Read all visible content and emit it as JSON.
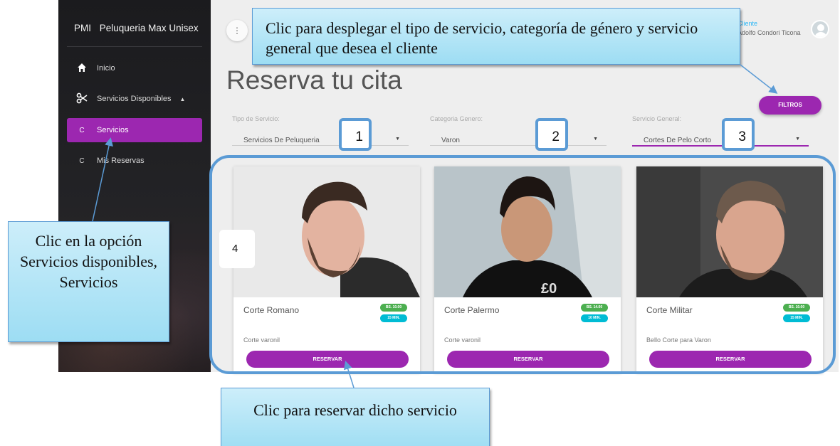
{
  "sidebar": {
    "brand_abbr": "PMI",
    "brand_name": "Peluqueria Max Unisex",
    "items": [
      {
        "icon": "home-icon",
        "label": "Inicio"
      },
      {
        "icon": "scissors-icon",
        "label": "Servicios Disponibles"
      },
      {
        "letter": "C",
        "label": "Servicios",
        "active": true
      },
      {
        "letter": "C",
        "label": "Mis Reservas"
      }
    ]
  },
  "header": {
    "user_role": "Cliente",
    "user_name": "Adolfo Condori Ticona"
  },
  "main": {
    "title": "Reserva tu cita",
    "filters_button": "FILTROS",
    "filters": [
      {
        "label": "Tipo de Servicio:",
        "value": "Servicios De Peluqueria"
      },
      {
        "label": "Categoria Genero:",
        "value": "Varon"
      },
      {
        "label": "Servicio General:",
        "value": "Cortes De Pelo Corto"
      }
    ],
    "cards": [
      {
        "name": "Corte Romano",
        "price": "BS. 10.00",
        "time": "15 MIN.",
        "description": "Corte varonil",
        "button": "RESERVAR"
      },
      {
        "name": "Corte Palermo",
        "price": "BS. 14.00",
        "time": "10 MIN.",
        "description": "Corte varonil",
        "button": "RESERVAR"
      },
      {
        "name": "Corte Militar",
        "price": "BS. 10.00",
        "time": "15 MIN.",
        "description": "Bello Corte para Varon",
        "button": "RESERVAR"
      }
    ]
  },
  "annotations": {
    "top_callout": "Clic para desplegar el tipo de servicio, categoría de género y servicio general que desea el cliente",
    "left_callout": "Clic en la opción Servicios disponibles, Servicios",
    "bottom_callout": "Clic para reservar dicho servicio",
    "markers": [
      "1",
      "2",
      "3",
      "4"
    ]
  },
  "colors": {
    "accent": "#9c27b0",
    "sidebar_bg": "#1f1f22",
    "annotation_fill": "#bde8f7",
    "annotation_border": "#5b9bd5",
    "badge_price": "#4caf50",
    "badge_time": "#00bcd4"
  }
}
